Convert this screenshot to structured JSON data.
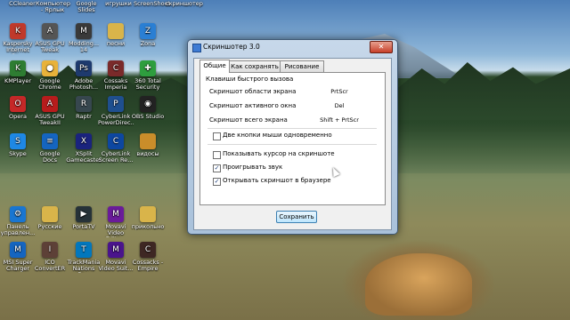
{
  "desktop": {
    "top_row": [
      "CCleaner",
      "Компьютер - Ярлык",
      "Google Slides",
      "игрушки",
      "ScreenShoot",
      "скриншотер"
    ],
    "icons": [
      {
        "label": "Kaspersky Internet Se...",
        "icon": "kaspersky-icon",
        "color": "#c0392b",
        "glyph": "K"
      },
      {
        "label": "ASUS GPU Tweak",
        "icon": "asus-icon",
        "color": "#555555",
        "glyph": "A"
      },
      {
        "label": "Modding... 14",
        "icon": "modding-icon",
        "color": "#3a3a3a",
        "glyph": "M"
      },
      {
        "label": "песни",
        "icon": "folder-icon",
        "color": "#d9b44a",
        "glyph": ""
      },
      {
        "label": "Zona",
        "icon": "zona-icon",
        "color": "#2a7fd4",
        "glyph": "Z"
      },
      {
        "label": "KMPlayer",
        "icon": "kmplayer-icon",
        "color": "#2e7d32",
        "glyph": "K"
      },
      {
        "label": "Google Chrome",
        "icon": "chrome-icon",
        "color": "#e8b23a",
        "glyph": "●"
      },
      {
        "label": "Adobe Photosh...",
        "icon": "photoshop-icon",
        "color": "#1e3a6e",
        "glyph": "Ps"
      },
      {
        "label": "Cossaks Imperia",
        "icon": "cossacks-icon",
        "color": "#7a2a2a",
        "glyph": "C"
      },
      {
        "label": "360 Total Security",
        "icon": "security-icon",
        "color": "#2e9e3e",
        "glyph": "✚"
      },
      {
        "label": "Opera",
        "icon": "opera-icon",
        "color": "#c62828",
        "glyph": "O"
      },
      {
        "label": "ASUS GPU TweakII",
        "icon": "asus-tweak-icon",
        "color": "#b71c1c",
        "glyph": "A"
      },
      {
        "label": "Raptr",
        "icon": "raptr-icon",
        "color": "#37474f",
        "glyph": "R"
      },
      {
        "label": "CyberLink PowerDirec...",
        "icon": "powerdirector-icon",
        "color": "#1f4f8f",
        "glyph": "P"
      },
      {
        "label": "OBS Studio",
        "icon": "obs-icon",
        "color": "#222222",
        "glyph": "◉"
      },
      {
        "label": "Skype",
        "icon": "skype-icon",
        "color": "#1e88e5",
        "glyph": "S"
      },
      {
        "label": "Google Docs",
        "icon": "docs-icon",
        "color": "#1565c0",
        "glyph": "≡"
      },
      {
        "label": "XSplit Gamecaster",
        "icon": "xsplit-icon",
        "color": "#1a237e",
        "glyph": "X"
      },
      {
        "label": "CyberLink Screen Re...",
        "icon": "screenrecorder-icon",
        "color": "#0d47a1",
        "glyph": "C"
      },
      {
        "label": "видосы",
        "icon": "video-folder-icon",
        "color": "#c98d2a",
        "glyph": ""
      },
      {
        "label": "Панель управлен...",
        "icon": "control-panel-icon",
        "color": "#1976d2",
        "glyph": "⚙"
      },
      {
        "label": "Русские",
        "icon": "folder-icon",
        "color": "#d9b44a",
        "glyph": ""
      },
      {
        "label": "PortaTV",
        "icon": "portatv-icon",
        "color": "#263238",
        "glyph": "▶"
      },
      {
        "label": "Movavi Video Edito...",
        "icon": "movavi-icon",
        "color": "#6a1b9a",
        "glyph": "M"
      },
      {
        "label": "прикольно",
        "icon": "folder-icon",
        "color": "#d9b44a",
        "glyph": ""
      },
      {
        "label": "MSI Super Charger",
        "icon": "msi-icon",
        "color": "#1565c0",
        "glyph": "M"
      },
      {
        "label": "ICO ConvertER",
        "icon": "ico-convert-icon",
        "color": "#5d4037",
        "glyph": "I"
      },
      {
        "label": "TrackMania Nations Fo...",
        "icon": "trackmania-icon",
        "color": "#0277bd",
        "glyph": "T"
      },
      {
        "label": "Movavi Video Suit...",
        "icon": "movavi-suite-icon",
        "color": "#4a148c",
        "glyph": "M"
      },
      {
        "label": "Cossacks - Empire",
        "icon": "cossacks2-icon",
        "color": "#3e2723",
        "glyph": "C"
      }
    ]
  },
  "dialog": {
    "title": "Скриншотер 3.0",
    "close_glyph": "✕",
    "tabs": [
      "Общие",
      "Как сохранять",
      "Рисование"
    ],
    "section_title": "Клавиши быстрого вызова",
    "hotkeys": [
      {
        "label": "Скриншот области экрана",
        "value": "PrtScr"
      },
      {
        "label": "Скриншот активного окна",
        "value": "Del"
      },
      {
        "label": "Скриншот всего экрана",
        "value": "Shift + PrtScr"
      }
    ],
    "options": [
      {
        "label": "Две кнопки мыши одновременно",
        "checked": false
      },
      {
        "label": "Показывать курсор на скриншоте",
        "checked": false
      },
      {
        "label": "Проигрывать звук",
        "checked": true
      },
      {
        "label": "Открывать скриншот в браузере",
        "checked": true
      }
    ],
    "save_label": "Сохранить"
  }
}
